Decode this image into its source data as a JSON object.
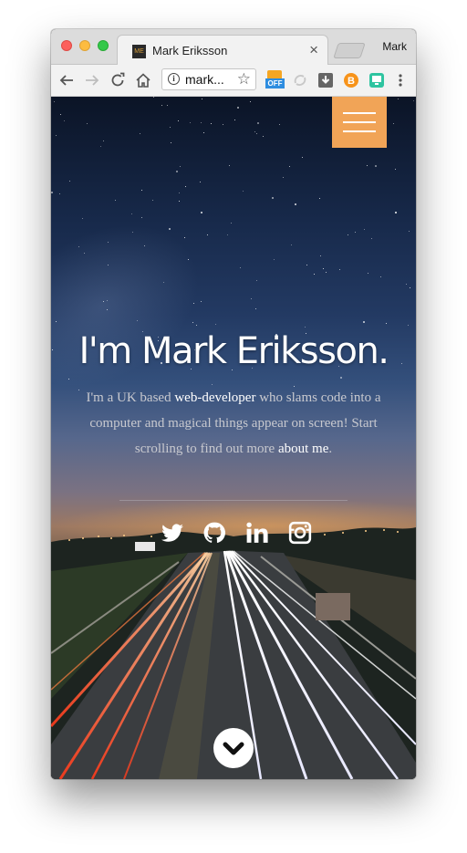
{
  "browser": {
    "tab_title": "Mark Eriksson",
    "favicon_text": "ME",
    "tab_close": "×",
    "profile_name": "Mark",
    "address_text": "mark...",
    "extensions": [
      "coupon-off-icon",
      "sync-icon",
      "download-icon",
      "bitcoin-icon",
      "screen-icon"
    ],
    "extension_badge": "OFF"
  },
  "hero": {
    "title": "I'm Mark Eriksson.",
    "text_1": "I'm a UK based ",
    "link_webdev": "web-developer",
    "text_2": " who slams code into a computer and magical things appear on screen! Start scrolling to find out more ",
    "link_about": "about me",
    "text_3": "."
  },
  "social": [
    "twitter-icon",
    "github-icon",
    "linkedin-icon",
    "instagram-icon"
  ],
  "colors": {
    "menu_button": "#f1a457",
    "link": "#ffffff",
    "body_text": "#c8c9cf"
  }
}
